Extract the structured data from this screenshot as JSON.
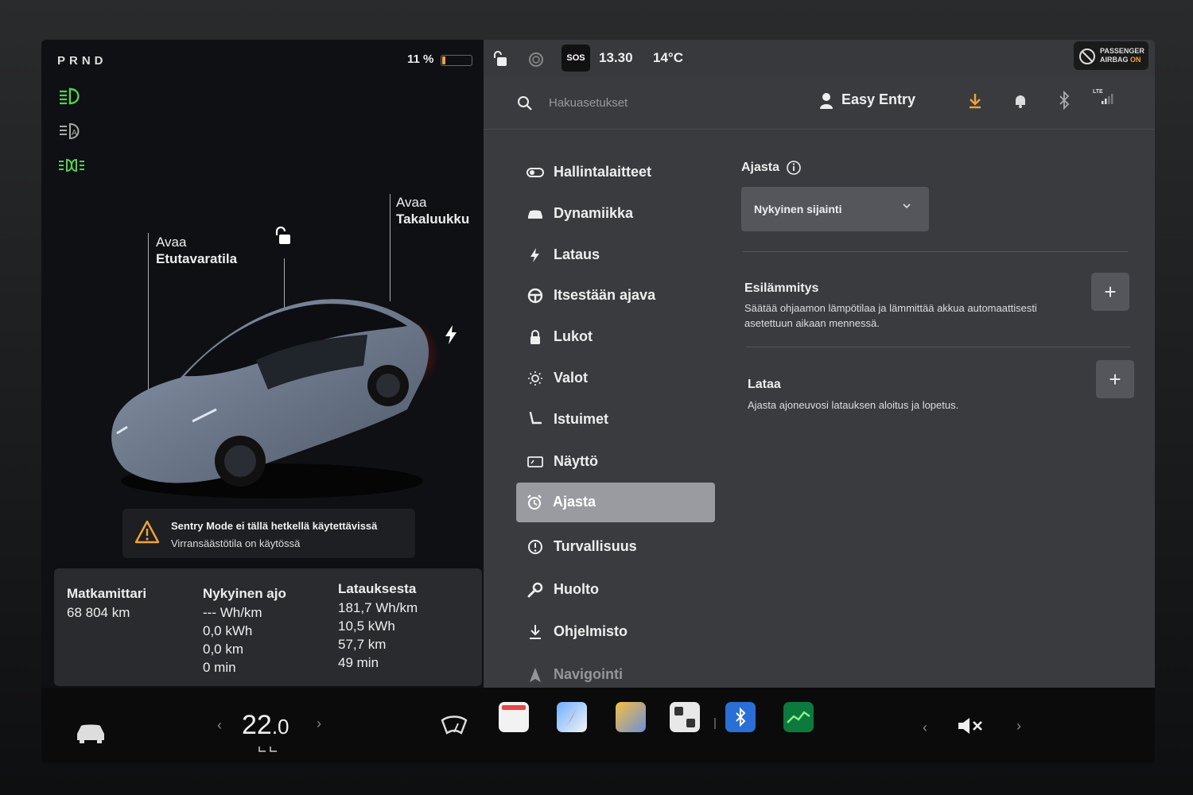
{
  "status": {
    "gear": "PRND",
    "battery": "11 %",
    "battery_level": 0.11,
    "time": "13.30",
    "temperature": "14°C",
    "sos": "SOS",
    "airbag_line1": "PASSENGER",
    "airbag_line2": "AIRBAG",
    "airbag_state": "ON"
  },
  "car": {
    "frunk_label1": "Avaa",
    "frunk_label2": "Etutavaratila",
    "trunk_label1": "Avaa",
    "trunk_label2": "Takaluukku"
  },
  "sentry": {
    "title": "Sentry Mode ei tällä hetkellä käytettävissä",
    "subtitle": "Virransäästötila on käytössä"
  },
  "stats": {
    "odometer": {
      "title": "Matkamittari",
      "value": "68 804 km"
    },
    "current": {
      "title": "Nykyinen ajo",
      "lines": [
        "--- Wh/km",
        "0,0 kWh",
        "0,0 km",
        "0 min"
      ]
    },
    "since_charge": {
      "title": "Latauksesta",
      "lines": [
        "181,7 Wh/km",
        "10,5 kWh",
        "57,7 km",
        "49 min"
      ]
    }
  },
  "header": {
    "search_placeholder": "Hakuasetukset",
    "profile": "Easy Entry",
    "lte": "LTE"
  },
  "menu": [
    {
      "label": "Hallintalaitteet",
      "icon": "toggle-icon"
    },
    {
      "label": "Dynamiikka",
      "icon": "car-icon"
    },
    {
      "label": "Lataus",
      "icon": "bolt-icon"
    },
    {
      "label": "Itsestään ajava",
      "icon": "steering-wheel-icon"
    },
    {
      "label": "Lukot",
      "icon": "lock-icon"
    },
    {
      "label": "Valot",
      "icon": "sun-icon"
    },
    {
      "label": "Istuimet",
      "icon": "seat-icon"
    },
    {
      "label": "Näyttö",
      "icon": "display-icon"
    },
    {
      "label": "Ajasta",
      "icon": "alarm-clock-icon"
    },
    {
      "label": "Turvallisuus",
      "icon": "info-circle-icon"
    },
    {
      "label": "Huolto",
      "icon": "wrench-icon"
    },
    {
      "label": "Ohjelmisto",
      "icon": "download-icon"
    },
    {
      "label": "Navigointi",
      "icon": "navigation-icon"
    }
  ],
  "content": {
    "title": "Ajasta",
    "location_value": "Nykyinen sijainti",
    "preheat": {
      "title": "Esilämmitys",
      "desc1": "Säätää ohjaamon lämpötilaa ja lämmittää akkua automaattisesti",
      "desc2": "asetettuun aikaan mennessä."
    },
    "charge": {
      "title": "Lataa",
      "desc": "Ajasta ajoneuvosi latauksen aloitus ja lopetus."
    },
    "plus": "+"
  },
  "dock": {
    "temp_int": "22",
    "temp_dec": ".0"
  },
  "colors": {
    "accent": "#f2a23a",
    "active_menu": "#9a9ba0",
    "green_light": "#4fd34f"
  }
}
